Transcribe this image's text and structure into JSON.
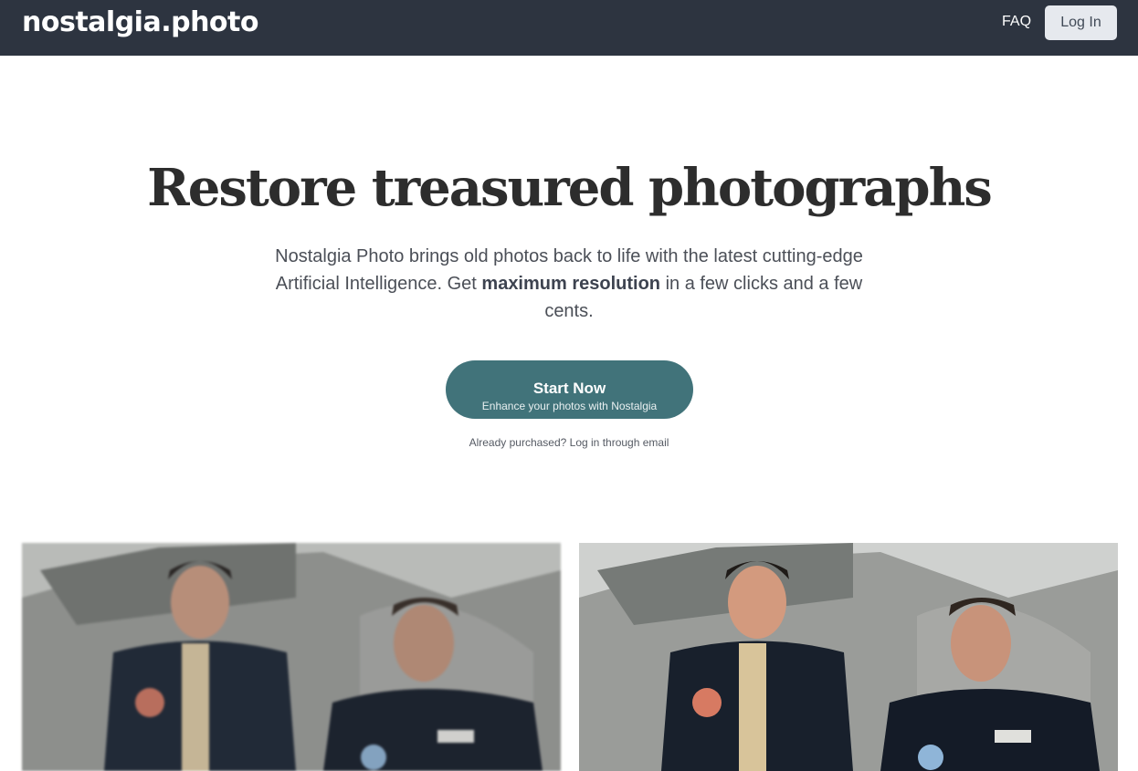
{
  "header": {
    "logo": "nostalgia.photo",
    "faq_label": "FAQ",
    "login_label": "Log In"
  },
  "hero": {
    "title": "Restore treasured photographs",
    "subtitle_part1": "Nostalgia Photo brings old photos back to life with the latest cutting-edge Artificial Intelligence. Get ",
    "subtitle_bold": "maximum resolution",
    "subtitle_part2": " in a few clicks and a few cents.",
    "cta_main": "Start Now",
    "cta_sub": "Enhance your photos with Nostalgia",
    "already_purchased": "Already purchased? Log in through email"
  },
  "colors": {
    "header_bg": "#2d3440",
    "cta_bg": "#41737a",
    "login_bg": "#e6e9ee"
  }
}
